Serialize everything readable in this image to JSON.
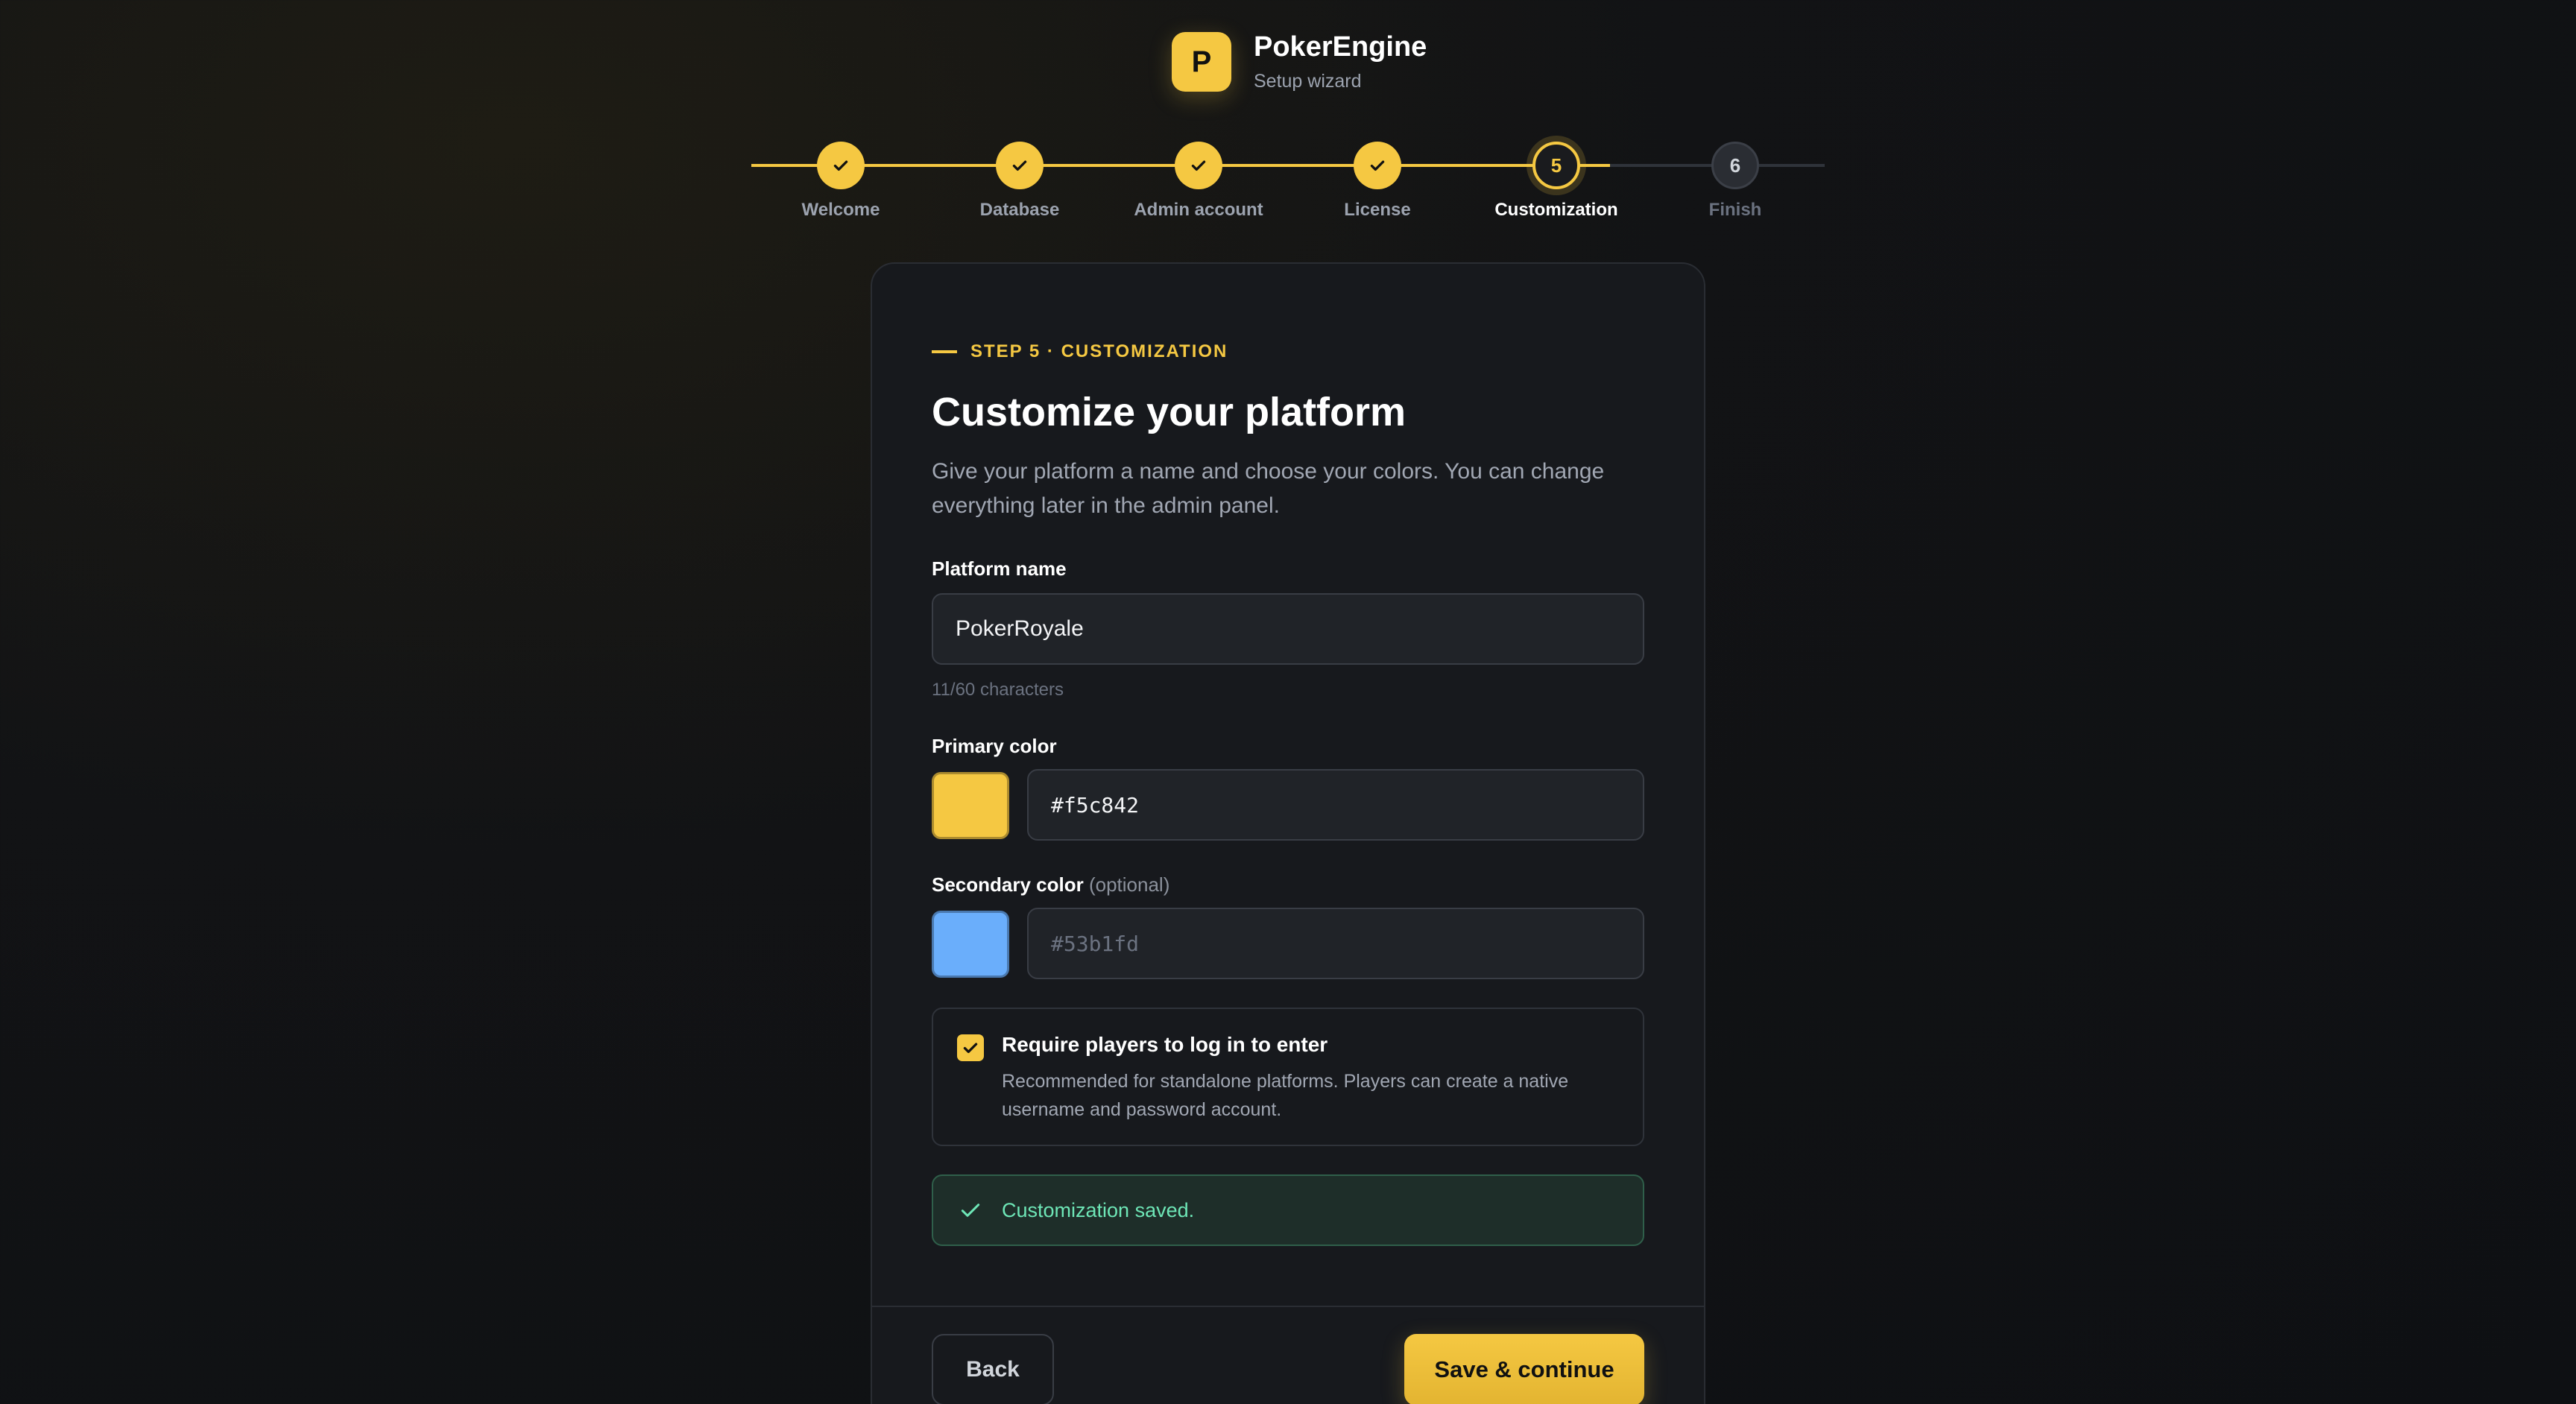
{
  "brand": {
    "logo_letter": "P",
    "name": "PokerEngine",
    "subtitle": "Setup wizard"
  },
  "stepper": {
    "steps": [
      {
        "label": "Welcome",
        "state": "done"
      },
      {
        "label": "Database",
        "state": "done"
      },
      {
        "label": "Admin account",
        "state": "done"
      },
      {
        "label": "License",
        "state": "done"
      },
      {
        "label": "Customization",
        "state": "current",
        "number": "5"
      },
      {
        "label": "Finish",
        "state": "todo",
        "number": "6"
      }
    ]
  },
  "card": {
    "eyebrow": "STEP 5 · CUSTOMIZATION",
    "title": "Customize your platform",
    "description": "Give your platform a name and choose your colors. You can change everything later in the admin panel.",
    "platform_name": {
      "label": "Platform name",
      "value": "PokerRoyale",
      "hint": "11/60 characters"
    },
    "primary_color": {
      "label": "Primary color",
      "value": "#f5c842",
      "swatch": "#f5c842"
    },
    "secondary_color": {
      "label": "Secondary color",
      "optional": "(optional)",
      "placeholder": "#53b1fd",
      "swatch": "#6aaefb"
    },
    "require_login": {
      "checked": true,
      "title": "Require players to log in to enter",
      "description": "Recommended for standalone platforms. Players can create a native username and password account."
    },
    "status": {
      "message": "Customization saved.",
      "icon": "check-icon"
    },
    "back_label": "Back",
    "save_label": "Save & continue"
  },
  "colors": {
    "accent": "#f5c842",
    "success": "#6ee7b7"
  }
}
